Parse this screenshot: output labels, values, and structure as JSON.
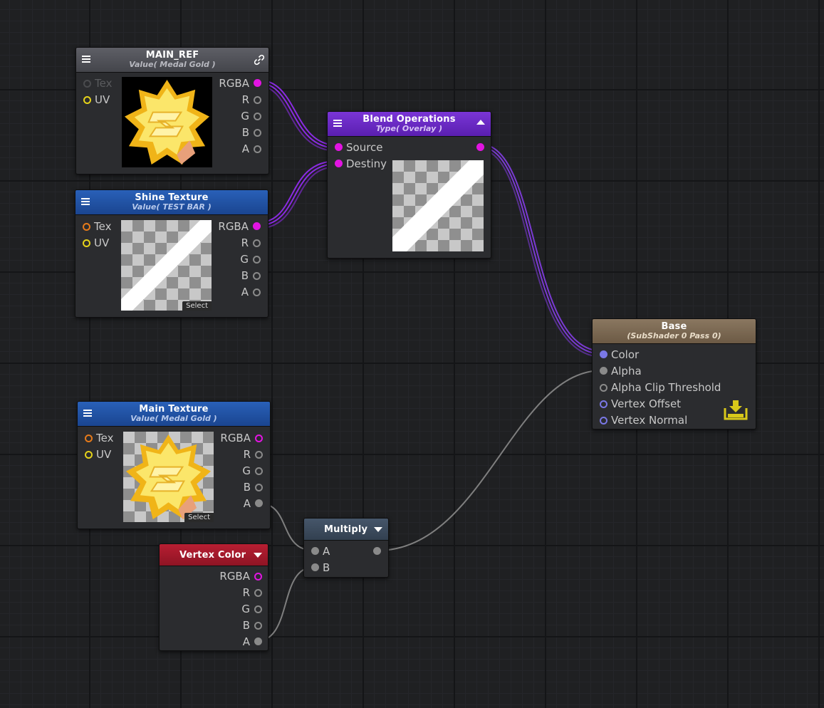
{
  "colors": {
    "texture_header": "#1f4fa0",
    "ref_header": "#4f5057",
    "blend_header": "#6a28c4",
    "vertex_header": "#a81a2c",
    "multiply_header": "#3c4a5a",
    "base_header": "#7d6a52",
    "wire_purple": "#8a2be2",
    "port_magenta": "#e214e2",
    "port_yellow": "#e6d31a",
    "port_orange": "#e67a1a",
    "port_gray": "#8a8a8a",
    "port_blue": "#7a78e6"
  },
  "nodes": {
    "main_ref": {
      "title": "MAIN_REF",
      "subtitle": "Value( Medal Gold )",
      "inputs": [
        "Tex",
        "UV"
      ],
      "outputs": [
        "RGBA",
        "R",
        "G",
        "B",
        "A"
      ],
      "link_icon": "link-icon"
    },
    "shine_texture": {
      "title": "Shine Texture",
      "subtitle": "Value( TEST BAR )",
      "inputs": [
        "Tex",
        "UV"
      ],
      "outputs": [
        "RGBA",
        "R",
        "G",
        "B",
        "A"
      ],
      "select_label": "Select"
    },
    "blend_operations": {
      "title": "Blend Operations",
      "subtitle": "Type( Overlay )",
      "inputs": [
        "Source",
        "Destiny"
      ]
    },
    "base": {
      "title": "Base",
      "subtitle": "(SubShader 0 Pass 0)",
      "inputs": [
        "Color",
        "Alpha",
        "Alpha Clip Threshold",
        "Vertex Offset",
        "Vertex Normal"
      ],
      "icon": "download-icon"
    },
    "main_texture": {
      "title": "Main Texture",
      "subtitle": "Value( Medal Gold )",
      "inputs": [
        "Tex",
        "UV"
      ],
      "outputs": [
        "RGBA",
        "R",
        "G",
        "B",
        "A"
      ],
      "select_label": "Select"
    },
    "vertex_color": {
      "title": "Vertex Color",
      "outputs": [
        "RGBA",
        "R",
        "G",
        "B",
        "A"
      ]
    },
    "multiply": {
      "title": "Multiply",
      "inputs": [
        "A",
        "B"
      ]
    }
  }
}
